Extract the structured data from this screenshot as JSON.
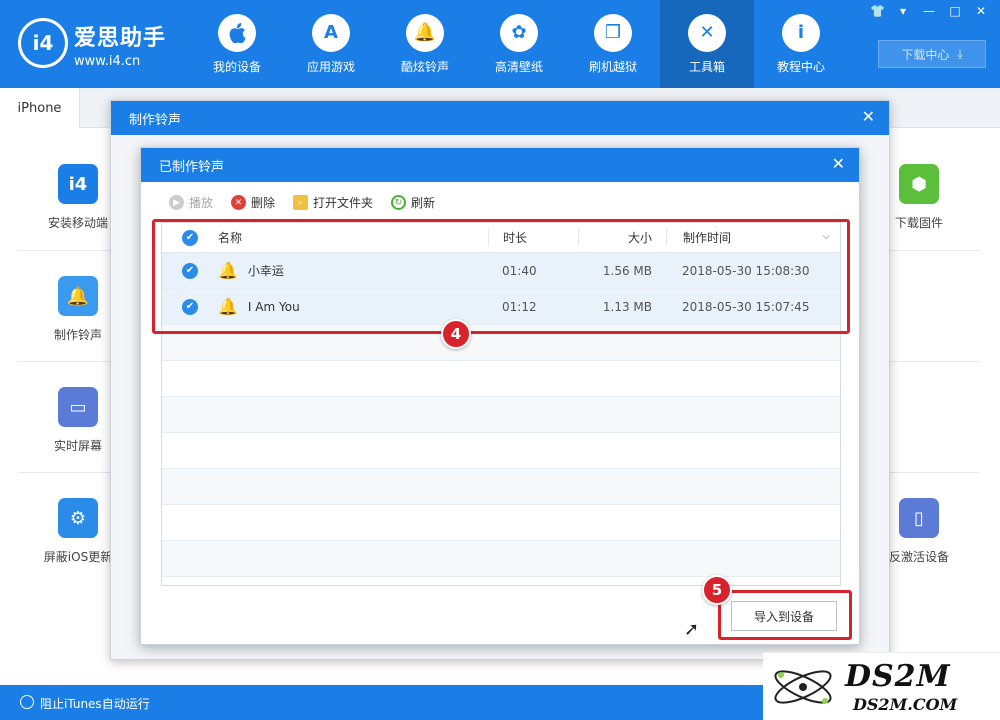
{
  "app": {
    "logo_text": "i4",
    "brand_name": "爱思助手",
    "brand_url": "www.i4.cn",
    "download_label": "下载中心"
  },
  "nav": [
    {
      "label": "我的设备",
      "icon": "apple-icon",
      "glyph": ""
    },
    {
      "label": "应用游戏",
      "icon": "appstore-icon",
      "glyph": "A"
    },
    {
      "label": "酷炫铃声",
      "icon": "bell-icon",
      "glyph": "🔔"
    },
    {
      "label": "高清壁纸",
      "icon": "flower-icon",
      "glyph": "✿"
    },
    {
      "label": "刷机越狱",
      "icon": "box-icon",
      "glyph": "❒"
    },
    {
      "label": "工具箱",
      "icon": "tools-icon",
      "glyph": "✕"
    },
    {
      "label": "教程中心",
      "icon": "info-icon",
      "glyph": "i"
    }
  ],
  "device_tab": "iPhone",
  "tools_left": [
    {
      "label": "安装移动端",
      "color": "#1b7ee6"
    },
    {
      "label": "制作铃声",
      "color": "#3a9af0"
    },
    {
      "label": "实时屏幕",
      "color": "#5c7bd6"
    },
    {
      "label": "屏蔽iOS更新",
      "color": "#2a8be9"
    }
  ],
  "tools_right": [
    {
      "label": "下载固件",
      "color": "#5cbf3c"
    },
    {
      "label": "反激活设备",
      "color": "#5c7bd6"
    }
  ],
  "status": {
    "label": "阻止iTunes自动运行"
  },
  "outer_dialog": {
    "title": "制作铃声"
  },
  "inner_dialog": {
    "title": "已制作铃声",
    "toolbar": {
      "play": "播放",
      "delete": "删除",
      "open_folder": "打开文件夹",
      "refresh": "刷新"
    },
    "columns": {
      "name": "名称",
      "duration": "时长",
      "size": "大小",
      "created": "制作时间"
    },
    "rows": [
      {
        "name": "小幸运",
        "duration": "01:40",
        "size": "1.56 MB",
        "created": "2018-05-30 15:08:30"
      },
      {
        "name": "I Am You",
        "duration": "01:12",
        "size": "1.13 MB",
        "created": "2018-05-30 15:07:45"
      }
    ],
    "import_label": "导入到设备"
  },
  "annotations": {
    "step4": "4",
    "step5": "5"
  },
  "colors": {
    "primary": "#1b7ee6",
    "highlight": "#d9232c"
  },
  "watermark": {
    "main": "DS2M",
    "sub": "DS2M.COM"
  }
}
